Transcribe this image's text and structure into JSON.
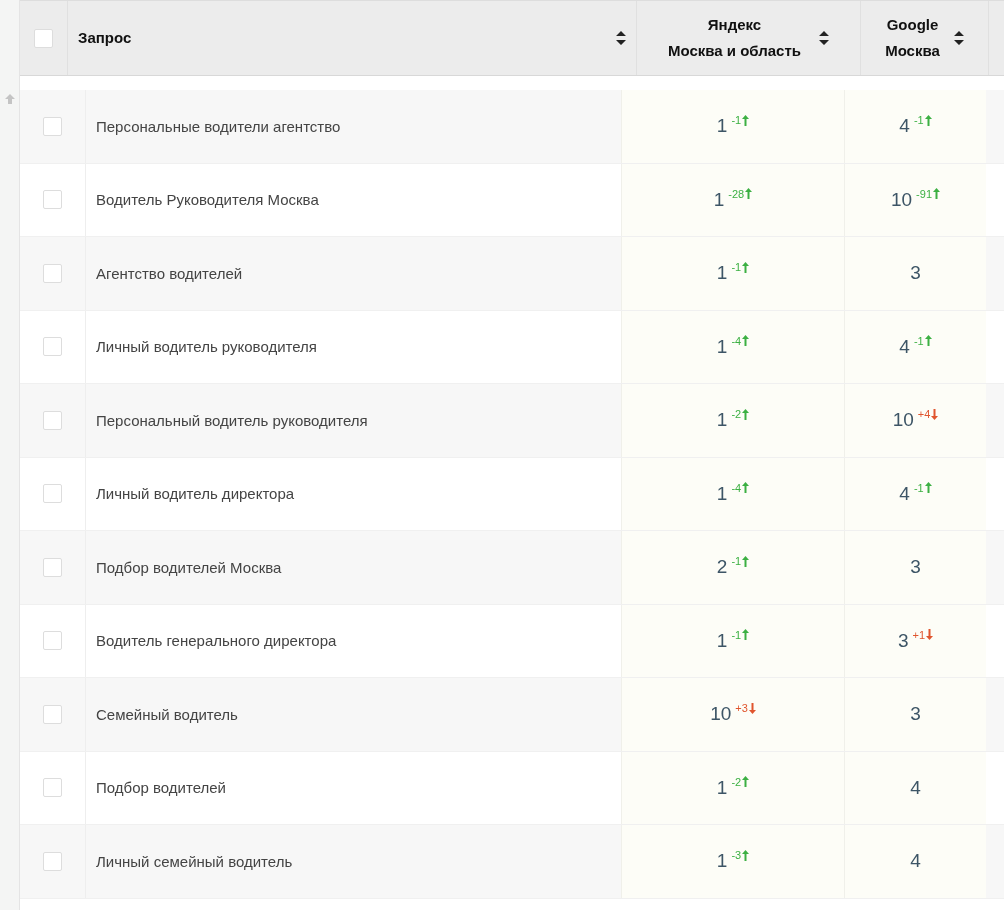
{
  "header": {
    "select_all": {
      "checked": false
    },
    "columns": [
      {
        "kind": "query",
        "lines": [
          "Запрос"
        ]
      },
      {
        "kind": "engine",
        "lines": [
          "Яндекс",
          "Москва и область"
        ]
      },
      {
        "kind": "engine",
        "lines": [
          "Google",
          "Москва"
        ]
      }
    ]
  },
  "rows": [
    {
      "query": "Персональные водители агентство",
      "checked": false,
      "positions": [
        {
          "value": "1",
          "change": "-1",
          "kind": "up"
        },
        {
          "value": "4",
          "change": "-1",
          "kind": "up"
        }
      ]
    },
    {
      "query": "Водитель Руководителя Москва",
      "checked": false,
      "positions": [
        {
          "value": "1",
          "change": "-28",
          "kind": "up"
        },
        {
          "value": "10",
          "change": "-91",
          "kind": "up"
        }
      ]
    },
    {
      "query": "Агентство водителей",
      "checked": false,
      "positions": [
        {
          "value": "1",
          "change": "-1",
          "kind": "up"
        },
        {
          "value": "3",
          "kind": "plain"
        }
      ]
    },
    {
      "query": "Личный водитель руководителя",
      "checked": false,
      "positions": [
        {
          "value": "1",
          "change": "-4",
          "kind": "up"
        },
        {
          "value": "4",
          "change": "-1",
          "kind": "up"
        }
      ]
    },
    {
      "query": "Персональный водитель руководителя",
      "checked": false,
      "positions": [
        {
          "value": "1",
          "change": "-2",
          "kind": "up"
        },
        {
          "value": "10",
          "change": "+4",
          "kind": "down"
        }
      ]
    },
    {
      "query": "Личный водитель директора",
      "checked": false,
      "positions": [
        {
          "value": "1",
          "change": "-4",
          "kind": "up"
        },
        {
          "value": "4",
          "change": "-1",
          "kind": "up"
        }
      ]
    },
    {
      "query": "Подбор водителей Москва",
      "checked": false,
      "positions": [
        {
          "value": "2",
          "change": "-1",
          "kind": "up"
        },
        {
          "value": "3",
          "kind": "plain"
        }
      ]
    },
    {
      "query": "Водитель генерального директора",
      "checked": false,
      "positions": [
        {
          "value": "1",
          "change": "-1",
          "kind": "up"
        },
        {
          "value": "3",
          "change": "+1",
          "kind": "down"
        }
      ]
    },
    {
      "query": "Семейный водитель",
      "checked": false,
      "positions": [
        {
          "value": "10",
          "change": "+3",
          "kind": "down"
        },
        {
          "value": "3",
          "kind": "plain"
        }
      ]
    },
    {
      "query": "Подбор водителей",
      "checked": false,
      "positions": [
        {
          "value": "1",
          "change": "-2",
          "kind": "up"
        },
        {
          "value": "4",
          "kind": "plain"
        }
      ]
    },
    {
      "query": "Личный семейный водитель",
      "checked": false,
      "positions": [
        {
          "value": "1",
          "change": "-3",
          "kind": "up"
        },
        {
          "value": "4",
          "kind": "plain"
        }
      ]
    }
  ]
}
